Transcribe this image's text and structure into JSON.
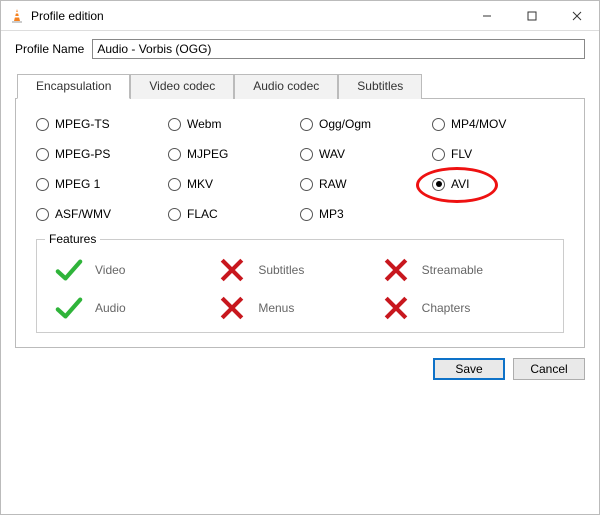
{
  "window": {
    "title": "Profile edition"
  },
  "profile": {
    "label": "Profile Name",
    "value": "Audio - Vorbis (OGG)"
  },
  "tabs": [
    {
      "label": "Encapsulation",
      "active": true
    },
    {
      "label": "Video codec",
      "active": false
    },
    {
      "label": "Audio codec",
      "active": false
    },
    {
      "label": "Subtitles",
      "active": false
    }
  ],
  "encapsulation": {
    "options": [
      "MPEG-TS",
      "Webm",
      "Ogg/Ogm",
      "MP4/MOV",
      "MPEG-PS",
      "MJPEG",
      "WAV",
      "FLV",
      "MPEG 1",
      "MKV",
      "RAW",
      "AVI",
      "ASF/WMV",
      "FLAC",
      "MP3"
    ],
    "selected": "AVI",
    "highlighted": "AVI"
  },
  "features": {
    "title": "Features",
    "items": [
      {
        "label": "Video",
        "supported": true
      },
      {
        "label": "Subtitles",
        "supported": false
      },
      {
        "label": "Streamable",
        "supported": false
      },
      {
        "label": "Audio",
        "supported": true
      },
      {
        "label": "Menus",
        "supported": false
      },
      {
        "label": "Chapters",
        "supported": false
      }
    ]
  },
  "buttons": {
    "save": "Save",
    "cancel": "Cancel"
  }
}
